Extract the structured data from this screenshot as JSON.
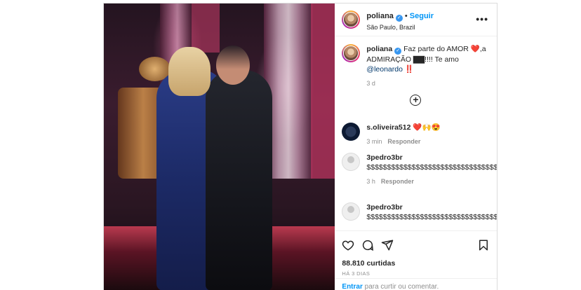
{
  "post": {
    "username": "poliana",
    "follow_label": "Seguir",
    "location": "São Paulo, Brazil",
    "more_label": "•••"
  },
  "caption": {
    "username": "poliana",
    "text": "Faz parte do AMOR ❤️,a ADMIRAÇÃO ▇▇!!!! Te amo",
    "mention": "@leonardo",
    "suffix": "‼️",
    "time": "3 d"
  },
  "load_more_label": "+",
  "comments": [
    {
      "username": "s.oliveira512",
      "text": "❤️🙌😍",
      "time": "3 min",
      "reply_label": "Responder"
    },
    {
      "username": "3pedro3br",
      "text": "$$$$$$$$$$$$$$$$$$$$$$$$$$$$$$$$$$$",
      "time": "3 h",
      "reply_label": "Responder"
    },
    {
      "username": "3pedro3br",
      "text": "$$$$$$$$$$$$$$$$$$$$$$$$$$$$$$$$$$$",
      "time": "",
      "reply_label": ""
    }
  ],
  "actions": {
    "likes": "88.810 curtidas",
    "date": "HÁ 3 DIAS"
  },
  "login_prompt": {
    "link": "Entrar",
    "text": " para curtir ou comentar."
  },
  "icons": [
    "heart-icon",
    "comment-icon",
    "share-icon",
    "bookmark-icon",
    "verified-icon",
    "more-icon",
    "add-comment-icon"
  ]
}
